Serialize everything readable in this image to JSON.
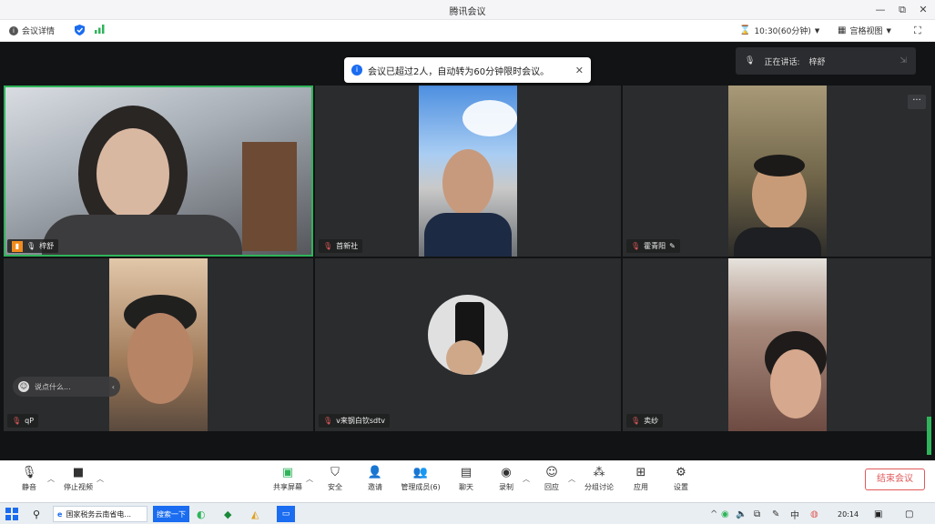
{
  "window": {
    "title": "腾讯会议",
    "minimize": "—",
    "restore": "⧉",
    "close": "✕"
  },
  "infobar": {
    "meeting_details": "会议详情",
    "timer": "10:30(60分钟)",
    "view": "宫格视图"
  },
  "notice": {
    "text": "会议已超过2人，自动转为60分钟限时会议。"
  },
  "speaking": {
    "label": "正在讲话:",
    "name": "梓舒"
  },
  "participants": [
    {
      "name": "梓舒"
    },
    {
      "name": "首新社"
    },
    {
      "name": "霍青阳"
    },
    {
      "name": "qP"
    },
    {
      "name": "v来钢白钦sdtv"
    },
    {
      "name": "卖纱"
    }
  ],
  "chat_popup": {
    "text": "说点什么..."
  },
  "toolbar": {
    "mute": "静音",
    "stop_video": "停止视频",
    "share_screen": "共享屏幕",
    "security": "安全",
    "invite": "邀请",
    "manage_members": "管理成员(6)",
    "chat": "聊天",
    "record": "录制",
    "reactions": "回应",
    "breakout": "分组讨论",
    "apps": "应用",
    "settings": "设置",
    "end_meeting": "结束会议"
  },
  "taskbar": {
    "browser_tab": "国家税务云南省电...",
    "search_button": "搜索一下",
    "clock": "20:14"
  },
  "colors": {
    "active_border": "#2fb45a",
    "end_red": "#e05a5a",
    "notice_blue": "#1a6cf0"
  }
}
